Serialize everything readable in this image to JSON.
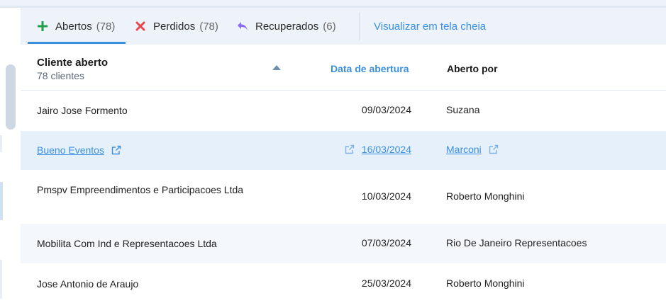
{
  "tabs": [
    {
      "label": "Abertos",
      "count": "(78)",
      "icon": "plus-icon",
      "color": "#1e9e4a"
    },
    {
      "label": "Perdidos",
      "count": "(78)",
      "icon": "x-icon",
      "color": "#e8484d"
    },
    {
      "label": "Recuperados",
      "count": "(6)",
      "icon": "reply-arrow-icon",
      "color": "#8b6cf0"
    }
  ],
  "fullscreen_link": "Visualizar em tela cheia",
  "table": {
    "header": {
      "client": "Cliente aberto",
      "client_count": "78 clientes",
      "date": "Data de abertura",
      "opened_by": "Aberto por"
    },
    "rows": [
      {
        "client": "Jairo Jose Formento",
        "date": "09/03/2024",
        "opened_by": "Suzana"
      },
      {
        "client": "Bueno Eventos",
        "date": "16/03/2024",
        "opened_by": "Marconi"
      },
      {
        "client": "Pmspv Empreendimentos e Participacoes Ltda",
        "date": "10/03/2024",
        "opened_by": "Roberto Monghini"
      },
      {
        "client": "Mobilita Com Ind e Representacoes Ltda",
        "date": "07/03/2024",
        "opened_by": "Rio De Janeiro Representacoes"
      },
      {
        "client": "Jose Antonio de Araujo",
        "date": "25/03/2024",
        "opened_by": "Roberto Monghini"
      }
    ]
  },
  "colors": {
    "accent": "#3a8fde",
    "highlight_row": "#e6f0fb",
    "striped_row": "#f4f8fd"
  }
}
